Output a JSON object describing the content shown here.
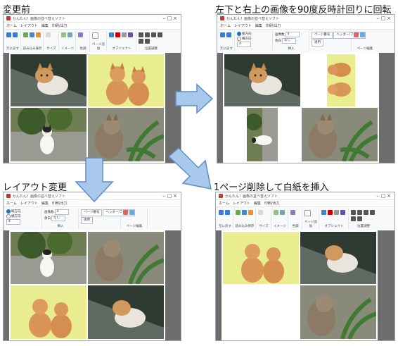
{
  "panels": {
    "top_left": {
      "title": "変更前"
    },
    "top_right": {
      "title": "左下と右上の画像を90度反時計回りに回転"
    },
    "bottom_left": {
      "title": "レイアウト変更"
    },
    "bottom_right": {
      "title": "1ページ削除して白紙を挿入"
    }
  },
  "window": {
    "title": "かんたん！画像の並べ替えソフト",
    "menu": [
      "ホーム",
      "レイアウト",
      "編集",
      "印刷/出力"
    ],
    "groups": {
      "file": "元に戻す",
      "save": "読み込み保存",
      "size": "サイズ",
      "image": "イメージ",
      "color": "色調",
      "layer": "ページ追加",
      "object": "オブジェクト",
      "arrange": "位置調整",
      "layout": "並び順",
      "insert": "挿入",
      "page_edit": "ページ編集"
    },
    "layout_options": {
      "opt_a": "縦方向",
      "opt_b": "横方向",
      "count_label": "画像数",
      "count_value": "4",
      "margin_label": "余白",
      "margin_value": "なし",
      "page_btn": "ページ番号",
      "header_btn": "ヘッダー/フッター",
      "apply_btn": "適用"
    }
  },
  "arrows": {
    "color": "#a8c9ec",
    "stroke": "#5d8ec7"
  }
}
